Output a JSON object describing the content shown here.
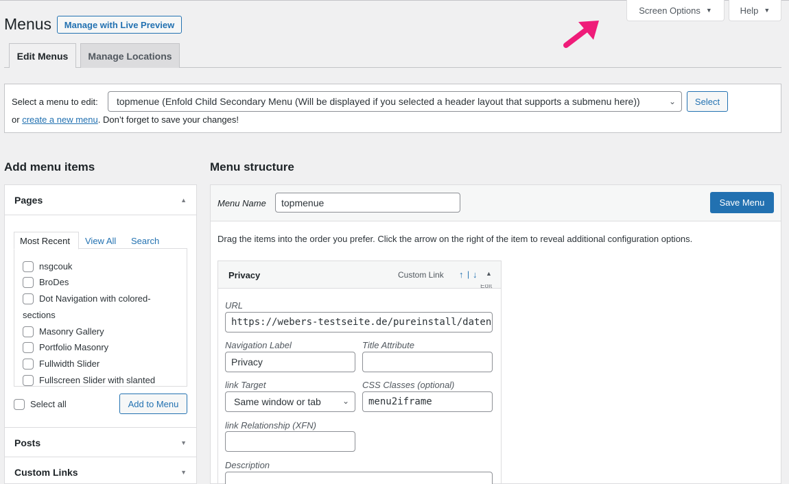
{
  "top": {
    "screen_options": "Screen Options",
    "help": "Help"
  },
  "page": {
    "title": "Menus",
    "live_preview": "Manage with Live Preview"
  },
  "tabs": {
    "edit": "Edit Menus",
    "manage": "Manage Locations"
  },
  "select_menu": {
    "label": "Select a menu to edit:",
    "value": "topmenue (Enfold Child Secondary Menu (Will be displayed if you selected a header layout that supports a submenu here))",
    "button": "Select",
    "or": "or",
    "create_link": "create a new menu",
    "reminder": ". Don’t forget to save your changes!"
  },
  "sidebar": {
    "title": "Add menu items",
    "pages_title": "Pages",
    "subtabs": [
      "Most Recent",
      "View All",
      "Search"
    ],
    "pages": [
      "nsgcouk",
      "BroDes",
      "Dot Navigation with colored-",
      "sections",
      "Masonry Gallery",
      "Portfolio Masonry",
      "Fullwidth Slider",
      "Fullscreen Slider with slanted"
    ],
    "select_all": "Select all",
    "add_button": "Add to Menu",
    "posts_title": "Posts",
    "custom_links_title": "Custom Links"
  },
  "structure": {
    "title": "Menu structure",
    "name_label": "Menu Name",
    "name_value": "topmenue",
    "save_button": "Save Menu",
    "instructions": "Drag the items into the order you prefer. Click the arrow on the right of the item to reveal additional configuration options."
  },
  "item": {
    "title": "Privacy",
    "type": "Custom Link",
    "edit": "Edit",
    "url_label": "URL",
    "url_value": "https://webers-testseite.de/pureinstall/datenschutz",
    "nav_label": "Navigation Label",
    "nav_value": "Privacy",
    "title_attr_label": "Title Attribute",
    "title_attr_value": "",
    "target_label": "link Target",
    "target_value": "Same window or tab",
    "css_label": "CSS Classes (optional)",
    "css_value": "menu2iframe",
    "xfn_label": "link Relationship (XFN)",
    "xfn_value": "",
    "desc_label": "Description"
  },
  "colors": {
    "accent": "#2271b1",
    "annotation_arrow": "#ef1c79"
  }
}
